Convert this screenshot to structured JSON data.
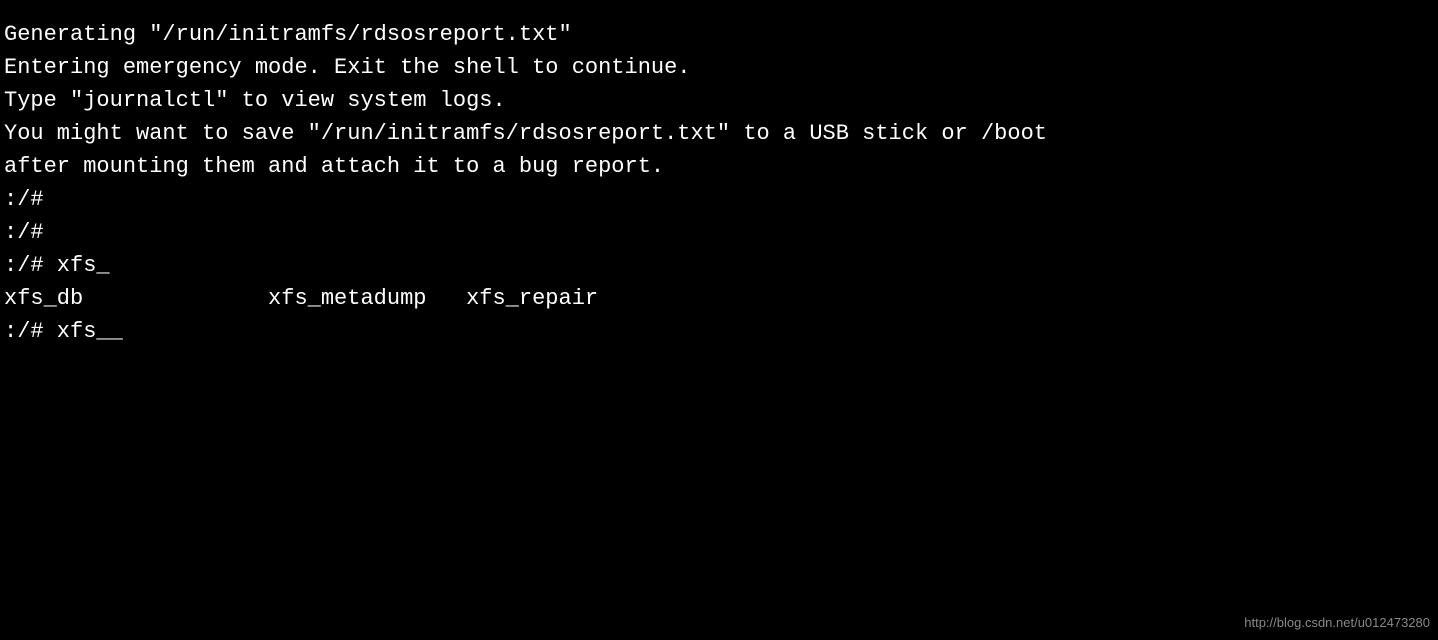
{
  "terminal": {
    "lines": [
      "Generating \"/run/initramfs/rdsosreport.txt\"",
      "",
      "",
      "Entering emergency mode. Exit the shell to continue.",
      "Type \"journalctl\" to view system logs.",
      "You might want to save \"/run/initramfs/rdsosreport.txt\" to a USB stick or /boot",
      "after mounting them and attach it to a bug report.",
      "",
      "",
      ":/# ",
      ":/# ",
      ":/# xfs_",
      "xfs_db              xfs_metadump   xfs_repair",
      ":/# xfs__"
    ],
    "watermark": "http://blog.csdn.net/u012473280"
  }
}
